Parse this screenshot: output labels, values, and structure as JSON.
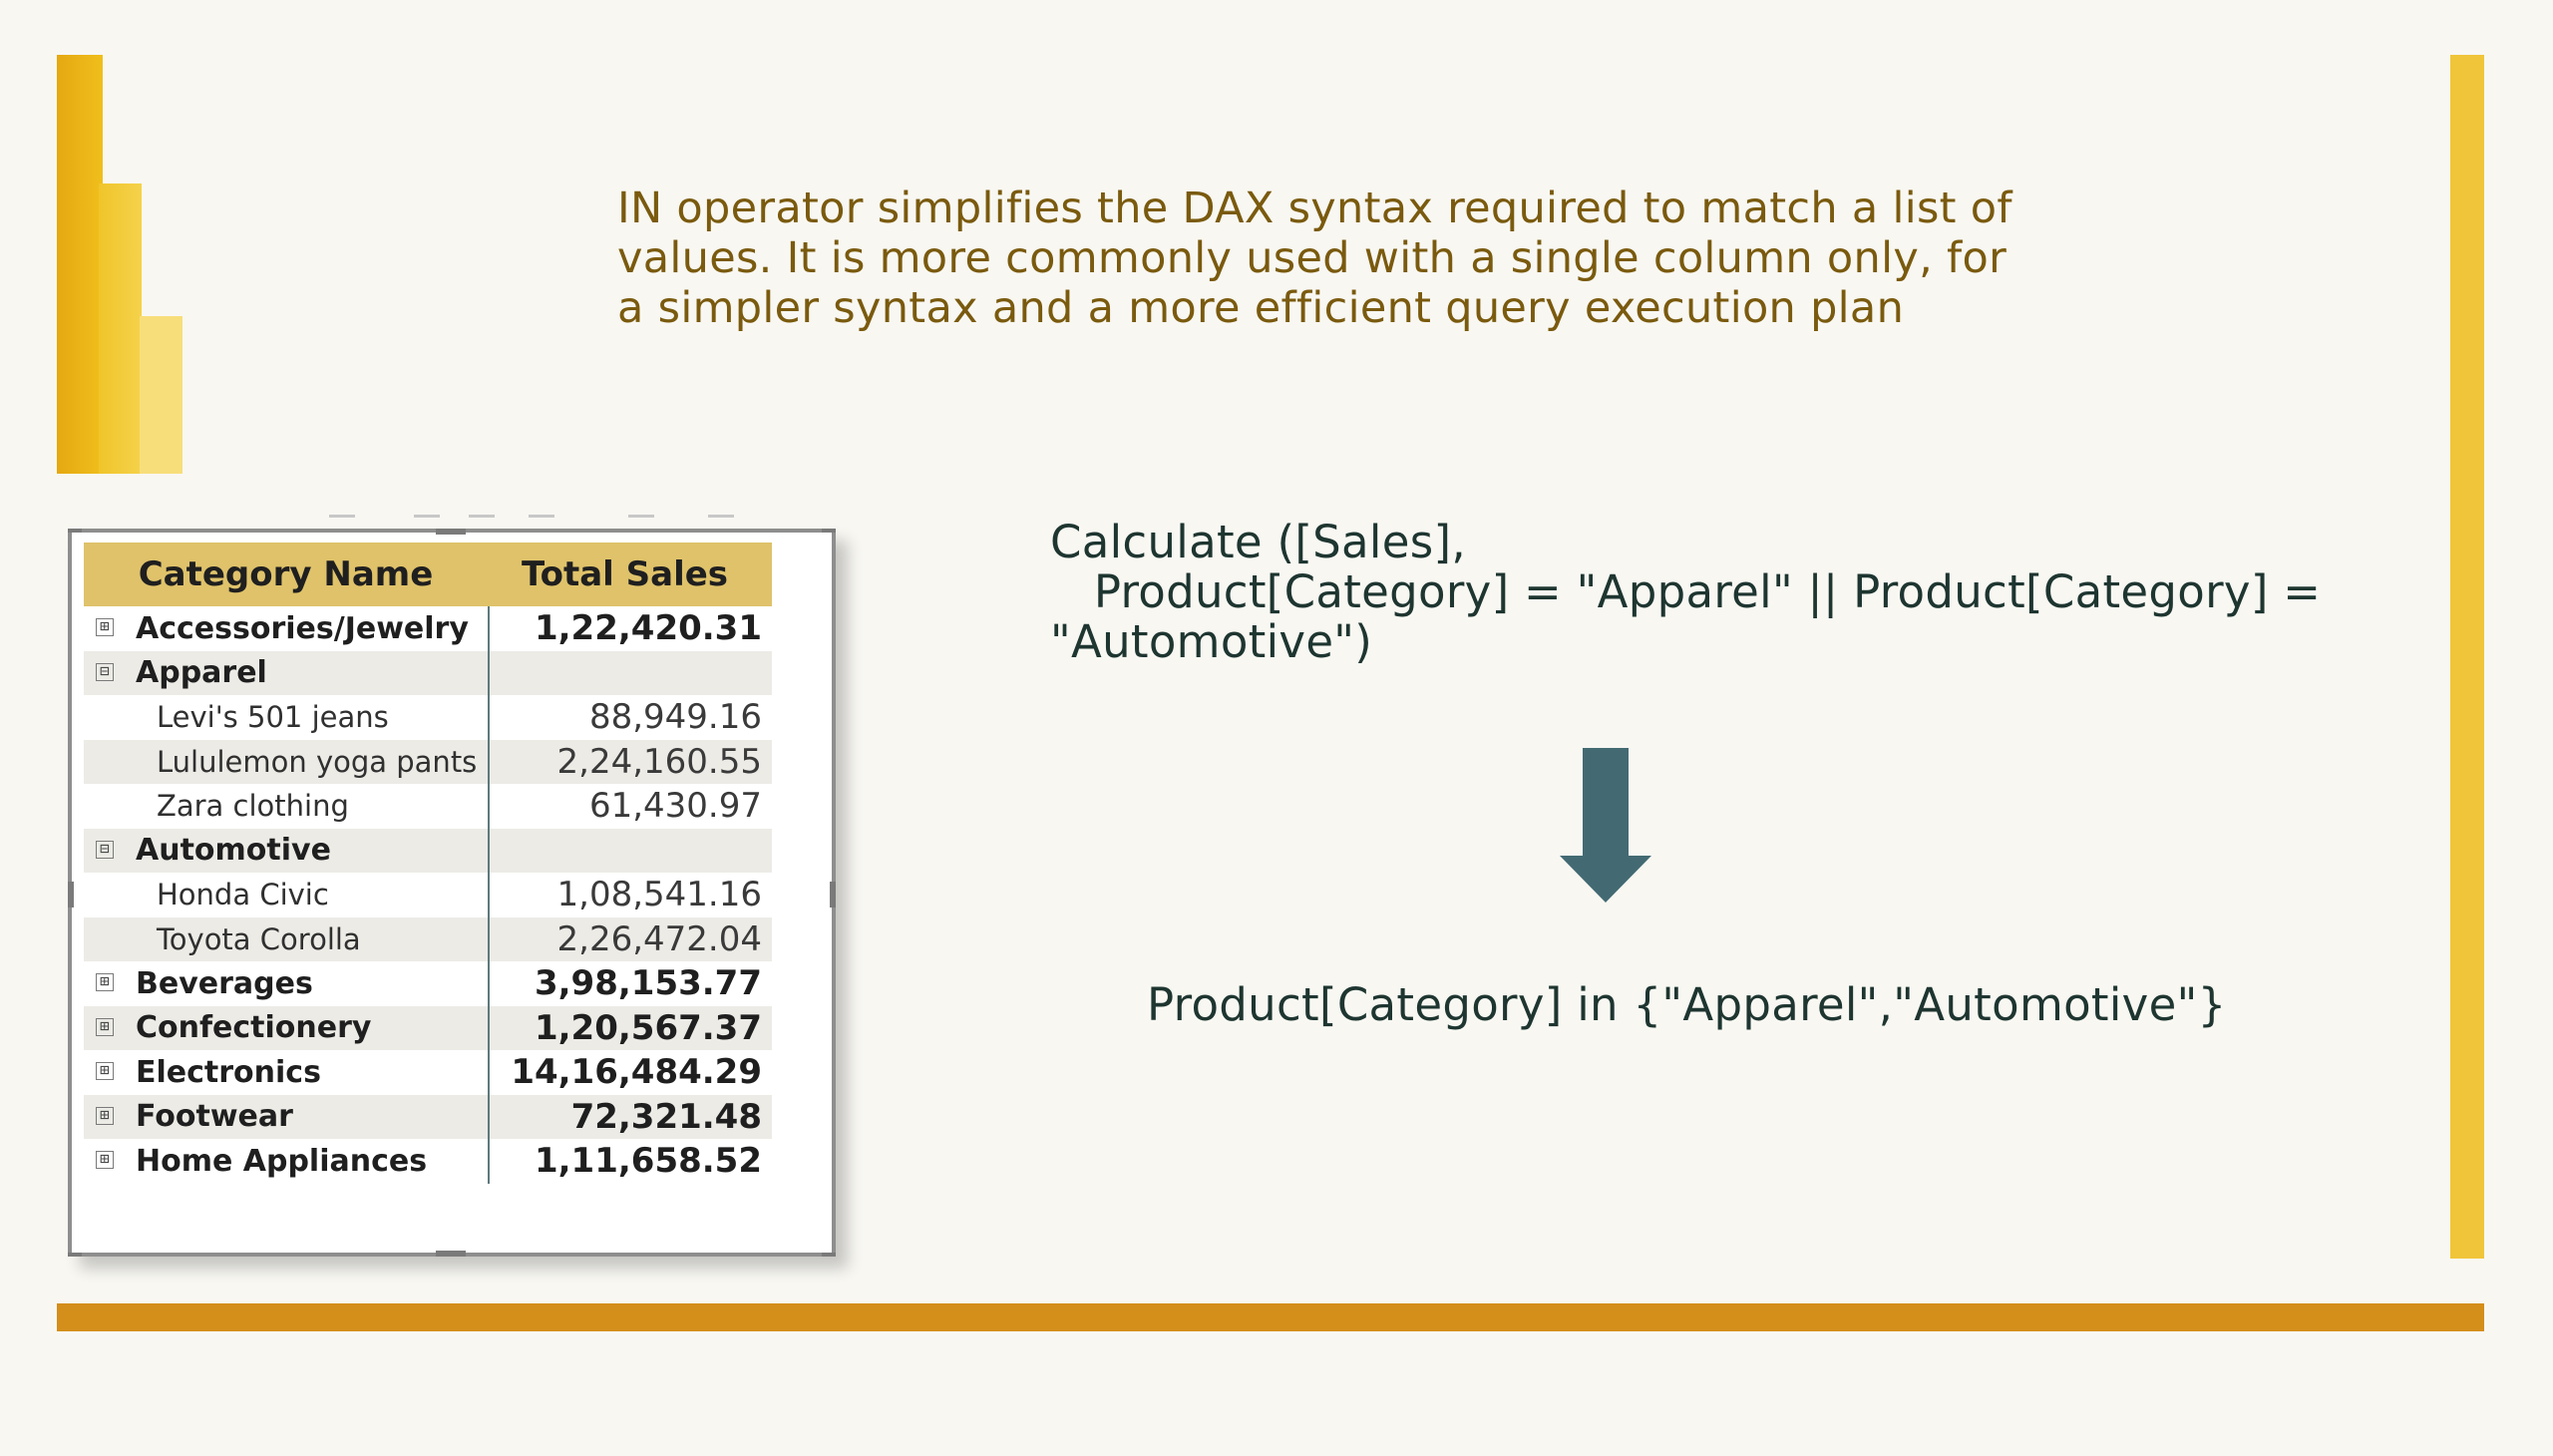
{
  "slide": {
    "intro": "IN operator simplifies the DAX syntax required to match a list of\nvalues. It is more commonly used with a single column only, for\na simpler syntax and a more efficient query execution plan",
    "code_before": "Calculate ([Sales],\n   Product[Category] = \"Apparel\" || Product[Category] =\n\"Automotive\")",
    "code_after": "Product[Category] in {\"Apparel\",\"Automotive\"}"
  },
  "matrix": {
    "headers": {
      "name": "Category Name",
      "value": "Total Sales"
    },
    "rows": [
      {
        "label": "Accessories/Jewelry",
        "value": "1,22,420.31",
        "level": "category",
        "expander": "⊞",
        "shade": false
      },
      {
        "label": "Apparel",
        "value": "",
        "level": "category",
        "expander": "⊟",
        "shade": true
      },
      {
        "label": "Levi's 501 jeans",
        "value": "88,949.16",
        "level": "item",
        "expander": "",
        "shade": false
      },
      {
        "label": "Lululemon yoga pants",
        "value": "2,24,160.55",
        "level": "item",
        "expander": "",
        "shade": true
      },
      {
        "label": "Zara clothing",
        "value": "61,430.97",
        "level": "item",
        "expander": "",
        "shade": false
      },
      {
        "label": "Automotive",
        "value": "",
        "level": "category",
        "expander": "⊟",
        "shade": true
      },
      {
        "label": "Honda Civic",
        "value": "1,08,541.16",
        "level": "item",
        "expander": "",
        "shade": false
      },
      {
        "label": "Toyota Corolla",
        "value": "2,26,472.04",
        "level": "item",
        "expander": "",
        "shade": true
      },
      {
        "label": "Beverages",
        "value": "3,98,153.77",
        "level": "category",
        "expander": "⊞",
        "shade": false
      },
      {
        "label": "Confectionery",
        "value": "1,20,567.37",
        "level": "category",
        "expander": "⊞",
        "shade": true
      },
      {
        "label": "Electronics",
        "value": "14,16,484.29",
        "level": "category",
        "expander": "⊞",
        "shade": false
      },
      {
        "label": "Footwear",
        "value": "72,321.48",
        "level": "category",
        "expander": "⊞",
        "shade": true
      },
      {
        "label": "Home Appliances",
        "value": "1,11,658.52",
        "level": "category",
        "expander": "⊞",
        "shade": false
      }
    ]
  },
  "colors": {
    "logo_dark": "#e5a812",
    "logo_mid": "#f0c52a",
    "logo_light": "#f8de7a",
    "accent_right": "#f0c53a",
    "accent_bottom": "#d48e1a",
    "intro_text": "#7a5a0e",
    "code_text": "#1e3530",
    "arrow": "#436a73",
    "matrix_header": "#dfc26a"
  },
  "icons": {
    "arrow": "arrow-down-icon",
    "expand": "expand-plus-icon",
    "collapse": "collapse-minus-icon"
  }
}
